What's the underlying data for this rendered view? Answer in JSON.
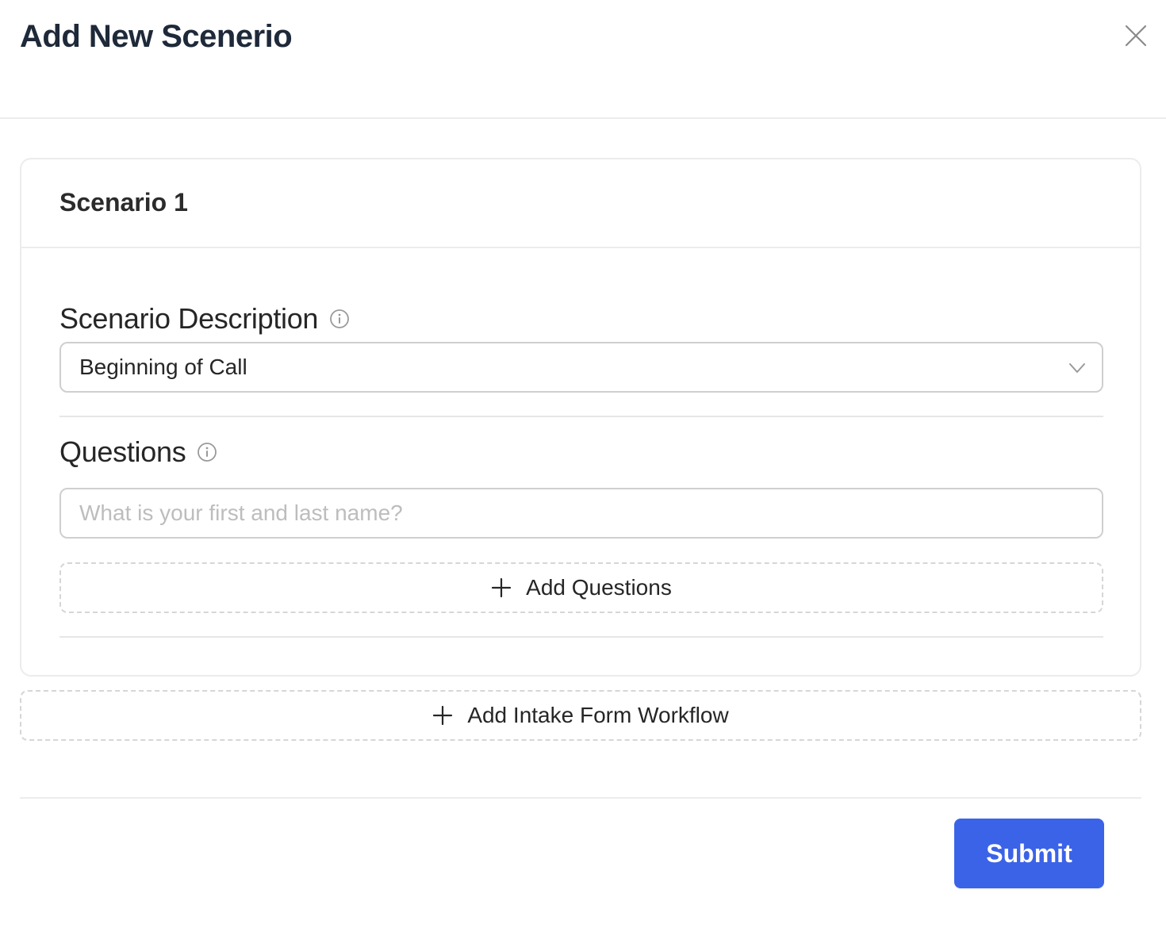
{
  "modal": {
    "title": "Add New Scenerio",
    "close_icon": "close-icon"
  },
  "scenario": {
    "title": "Scenario 1",
    "description": {
      "label": "Scenario Description",
      "info_icon": "info-icon",
      "selected_value": "Beginning of Call",
      "dropdown_icon": "chevron-down-icon"
    },
    "questions": {
      "label": "Questions",
      "info_icon": "info-icon",
      "input_value": "",
      "input_placeholder": "What is your first and last name?",
      "add_button_label": "Add Questions"
    }
  },
  "add_workflow_button_label": "Add Intake Form Workflow",
  "footer": {
    "submit_label": "Submit"
  },
  "colors": {
    "primary": "#3b63e8",
    "title": "#1e2939",
    "border": "#cfcfcf",
    "divider": "#ececec"
  }
}
